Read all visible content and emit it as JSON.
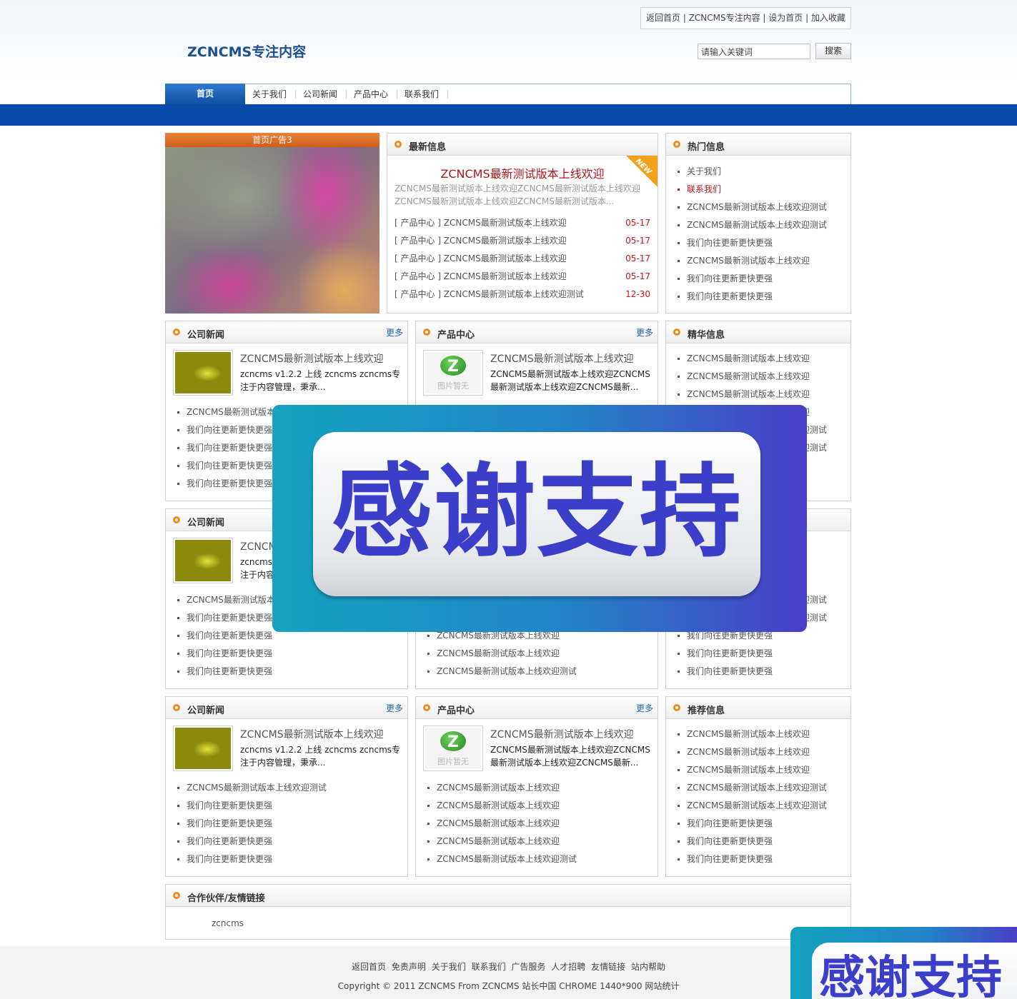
{
  "header": {
    "top_links": "返回首页 | ZCNCMS专注内容 | 设为首页 | 加入收藏",
    "logo": "ZCNCMS专注内容",
    "search_value": "请输入关键词",
    "search_button": "搜索"
  },
  "nav": {
    "home": "首页",
    "items": [
      "关于我们",
      "公司新闻",
      "产品中心",
      "联系我们"
    ]
  },
  "ad": {
    "label": "首页广告3"
  },
  "latest": {
    "title": "最新信息",
    "new_badge": "NEW",
    "headline": "ZCNCMS最新测试版本上线欢迎",
    "summary": "ZCNCMS最新测试版本上线欢迎ZCNCMS最新测试版本上线欢迎ZCNCMS最新测试版本上线欢迎ZCNCMS最新测试版本...",
    "items": [
      {
        "text": "[ 产品中心 ] ZCNCMS最新测试版本上线欢迎",
        "date": "05-17"
      },
      {
        "text": "[ 产品中心 ] ZCNCMS最新测试版本上线欢迎",
        "date": "05-17"
      },
      {
        "text": "[ 产品中心 ] ZCNCMS最新测试版本上线欢迎",
        "date": "05-17"
      },
      {
        "text": "[ 产品中心 ] ZCNCMS最新测试版本上线欢迎",
        "date": "05-17"
      },
      {
        "text": "[ 产品中心 ] ZCNCMS最新测试版本上线欢迎测试",
        "date": "12-30"
      }
    ]
  },
  "hot": {
    "title": "热门信息",
    "items": [
      "关于我们",
      "联系我们",
      "ZCNCMS最新测试版本上线欢迎测试",
      "ZCNCMS最新测试版本上线欢迎测试",
      "我们向往更新更快更强",
      "ZCNCMS最新测试版本上线欢迎",
      "我们向往更新更快更强",
      "我们向往更新更快更强"
    ]
  },
  "more_label": "更多",
  "row1": {
    "left": {
      "title": "公司新闻",
      "feat_title": "ZCNCMS最新测试版本上线欢迎",
      "feat_desc": "zcncms v1.2.2 上线 zcncms zcncms专注于内容管理，秉承...",
      "items": [
        "ZCNCMS最新测试版本上线欢迎测试",
        "我们向往更新更快更强",
        "我们向往更新更快更强",
        "我们向往更新更快更强",
        "我们向往更新更快更强"
      ]
    },
    "mid": {
      "title": "产品中心",
      "thumb_label": "图片暂无",
      "feat_title": "ZCNCMS最新测试版本上线欢迎",
      "feat_desc": "ZCNCMS最新测试版本上线欢迎ZCNCMS最新测试版本上线欢迎ZCNCMS最新..."
    },
    "right": {
      "title": "精华信息",
      "items": [
        "ZCNCMS最新测试版本上线欢迎",
        "ZCNCMS最新测试版本上线欢迎",
        "ZCNCMS最新测试版本上线欢迎",
        "ZCNCMS最新测试版本上线欢迎",
        "ZCNCMS最新测试版本上线欢迎测试",
        "ZCNCMS最新测试版本上线欢迎测试"
      ]
    }
  },
  "row2": {
    "left": {
      "title": "公司新闻",
      "feat_title": "ZCNCMS最新测试版本上线欢迎",
      "feat_desc": "zcncms v1.2.2 上线 zcncms zcncms专注于内容管理，秉承...",
      "items": [
        "ZCNCMS最新测试版本上线欢迎测试",
        "我们向往更新更快更强",
        "我们向往更新更快更强",
        "我们向往更新更快更强",
        "我们向往更新更快更强"
      ]
    },
    "mid": {
      "items": [
        "ZCNCMS最新测试版本上线欢迎",
        "ZCNCMS最新测试版本上线欢迎",
        "ZCNCMS最新测试版本上线欢迎测试"
      ]
    },
    "right": {
      "items": [
        "ZCNCMS最新测试版本上线欢迎测试",
        "ZCNCMS最新测试版本上线欢迎测试",
        "我们向往更新更快更强",
        "我们向往更新更快更强",
        "我们向往更新更快更强"
      ]
    }
  },
  "row3": {
    "left": {
      "title": "公司新闻",
      "feat_title": "ZCNCMS最新测试版本上线欢迎",
      "feat_desc": "zcncms v1.2.2 上线 zcncms zcncms专注于内容管理，秉承...",
      "items": [
        "ZCNCMS最新测试版本上线欢迎测试",
        "我们向往更新更快更强",
        "我们向往更新更快更强",
        "我们向往更新更快更强",
        "我们向往更新更快更强"
      ]
    },
    "mid": {
      "title": "产品中心",
      "thumb_label": "图片暂无",
      "feat_title": "ZCNCMS最新测试版本上线欢迎",
      "feat_desc": "ZCNCMS最新测试版本上线欢迎ZCNCMS最新测试版本上线欢迎ZCNCMS最新...",
      "items": [
        "ZCNCMS最新测试版本上线欢迎",
        "ZCNCMS最新测试版本上线欢迎",
        "ZCNCMS最新测试版本上线欢迎",
        "ZCNCMS最新测试版本上线欢迎",
        "ZCNCMS最新测试版本上线欢迎测试"
      ]
    },
    "right": {
      "title": "推荐信息",
      "items": [
        "ZCNCMS最新测试版本上线欢迎",
        "ZCNCMS最新测试版本上线欢迎",
        "ZCNCMS最新测试版本上线欢迎",
        "ZCNCMS最新测试版本上线欢迎测试",
        "ZCNCMS最新测试版本上线欢迎测试",
        "我们向往更新更快更强",
        "我们向往更新更快更强",
        "我们向往更新更快更强"
      ]
    }
  },
  "links": {
    "title": "合作伙伴/友情链接",
    "item": "zcncms"
  },
  "footer": {
    "links": [
      "返回首页",
      "免责声明",
      "关于我们",
      "联系我们",
      "广告服务",
      "人才招聘",
      "友情链接",
      "站内帮助"
    ],
    "copyright": "Copyright © 2011 ZCNCMS From ZCNCMS 站长中国 CHROME 1440*900 网站统计"
  },
  "overlay": {
    "text": "感谢支持"
  },
  "overlay2": {
    "text": "感谢支持"
  }
}
